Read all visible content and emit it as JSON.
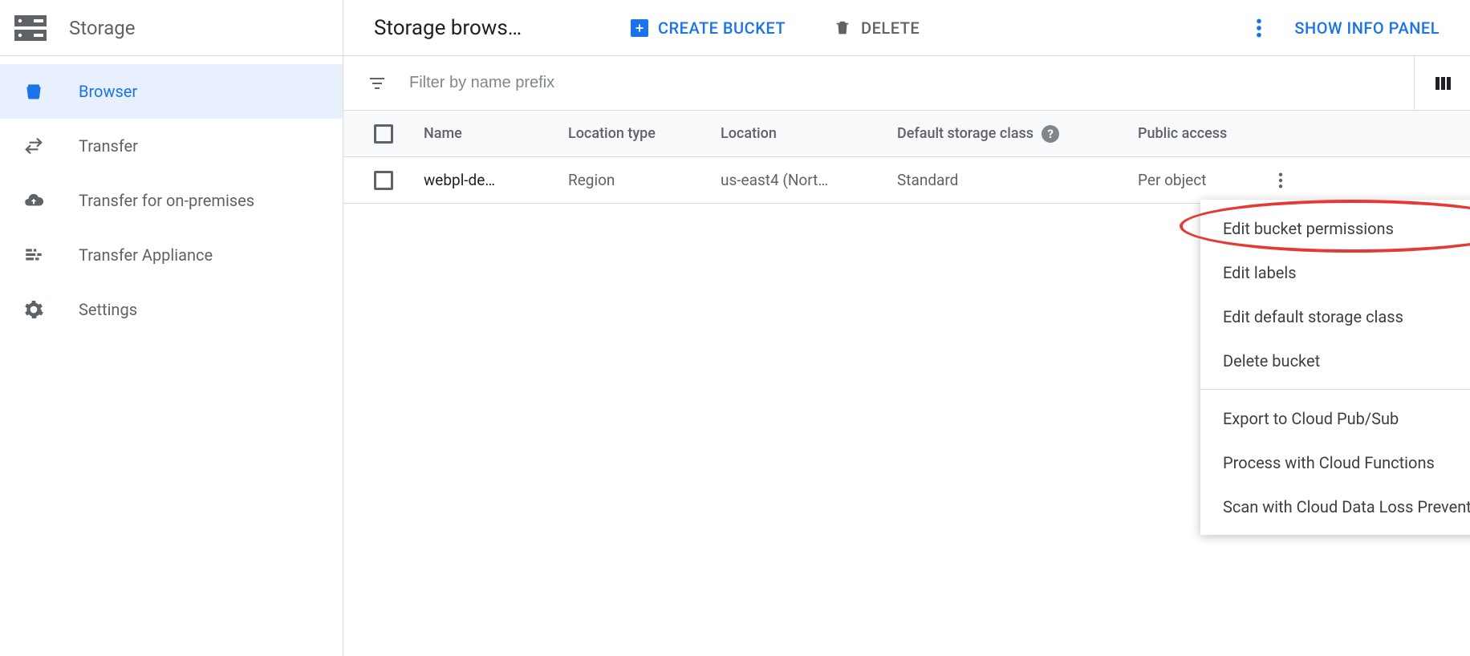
{
  "sidebar": {
    "title": "Storage",
    "items": [
      {
        "label": "Browser",
        "active": true
      },
      {
        "label": "Transfer"
      },
      {
        "label": "Transfer for on-premises"
      },
      {
        "label": "Transfer Appliance"
      },
      {
        "label": "Settings"
      }
    ]
  },
  "toolbar": {
    "title": "Storage brows…",
    "create": "CREATE BUCKET",
    "delete": "DELETE",
    "info_panel": "SHOW INFO PANEL"
  },
  "filter": {
    "placeholder": "Filter by name prefix"
  },
  "table": {
    "headers": {
      "name": "Name",
      "location_type": "Location type",
      "location": "Location",
      "storage_class": "Default storage class",
      "public_access": "Public access"
    },
    "rows": [
      {
        "name": "webpl-de…",
        "location_type": "Region",
        "location": "us-east4 (Nort…",
        "storage_class": "Standard",
        "public_access": "Per object"
      }
    ]
  },
  "menu": {
    "group1": [
      "Edit bucket permissions",
      "Edit labels",
      "Edit default storage class",
      "Delete bucket"
    ],
    "group2": [
      "Export to Cloud Pub/Sub",
      "Process with Cloud Functions",
      "Scan with Cloud Data Loss Prevention"
    ]
  }
}
